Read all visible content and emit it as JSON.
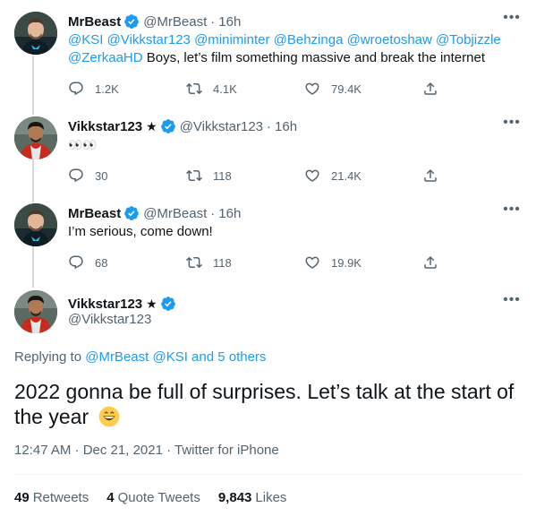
{
  "tweets": [
    {
      "name": "MrBeast",
      "star": "",
      "handle": "@MrBeast",
      "time": "16h",
      "mentions": "@KSI @Vikkstar123 @miniminter @Behzinga @wroetoshaw @Tobjizzle @ZerkaaHD",
      "text": " Boys, let’s film something massive and break the internet",
      "replies": "1.2K",
      "retweets": "4.1K",
      "likes": "79.4K"
    },
    {
      "name": "Vikkstar123",
      "star": "★",
      "handle": "@Vikkstar123",
      "time": "16h",
      "text": "👀👀",
      "replies": "30",
      "retweets": "118",
      "likes": "21.4K"
    },
    {
      "name": "MrBeast",
      "star": "",
      "handle": "@MrBeast",
      "time": "16h",
      "text": "I’m serious, come down!",
      "replies": "68",
      "retweets": "118",
      "likes": "19.9K"
    }
  ],
  "main": {
    "name": "Vikkstar123",
    "star": "★",
    "handle": "@Vikkstar123",
    "replying_prefix": "Replying to ",
    "replying_to": "@MrBeast @KSI and 5 others",
    "text": "2022 gonna be full of surprises. Let’s talk at the start of the year",
    "timestamp": "12:47 AM · Dec 21, 2021 · Twitter for iPhone",
    "retweets_count": "49",
    "retweets_label": "Retweets",
    "quotes_count": "4",
    "quotes_label": "Quote Tweets",
    "likes_count": "9,843",
    "likes_label": "Likes"
  },
  "colors": {
    "accent": "#1d9bf0",
    "secondary_text": "#536471",
    "primary_text": "#0f1419"
  },
  "icons": [
    "verified-badge-icon",
    "more-icon",
    "reply-icon",
    "retweet-icon",
    "like-icon",
    "share-icon",
    "grinning-emoji-icon"
  ]
}
